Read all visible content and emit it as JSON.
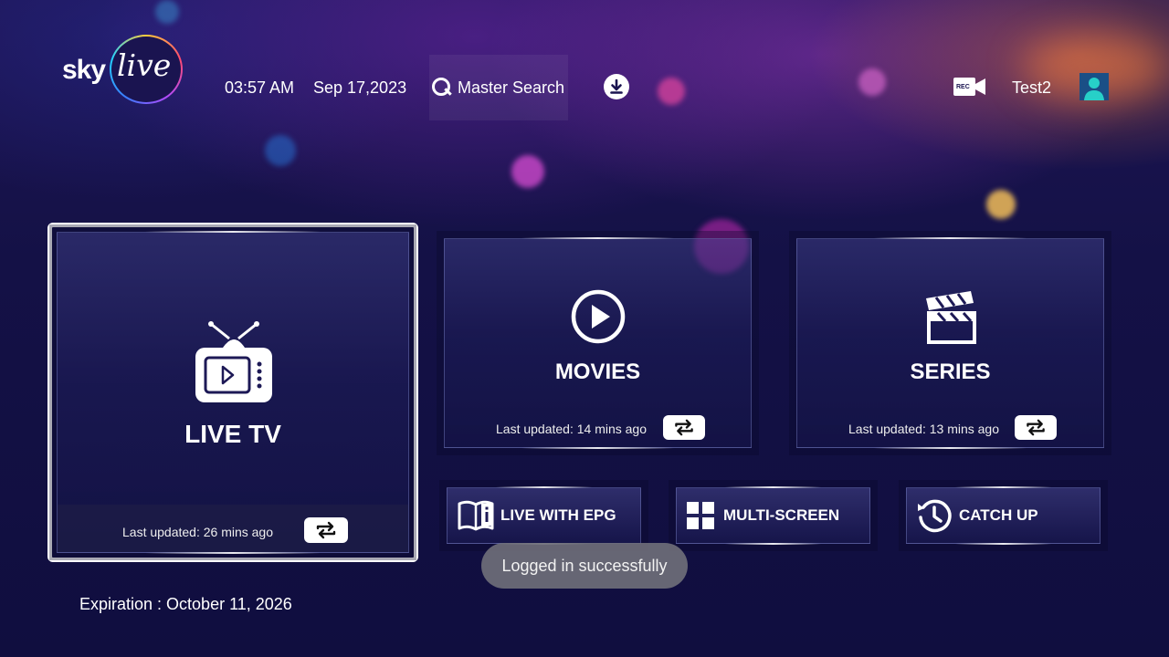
{
  "header": {
    "logo": {
      "brand_left": "sky",
      "brand_right": "live"
    },
    "time": "03:57 AM",
    "date": "Sep 17,2023",
    "search": {
      "label": "Master Search",
      "icon": "search-icon"
    },
    "download_icon": "download-icon",
    "record_icon": "rec-camera-icon",
    "record_badge": "REC",
    "username": "Test2",
    "avatar_icon": "user-avatar-icon"
  },
  "tiles": {
    "live_tv": {
      "title": "LIVE TV",
      "updated": "Last updated: 26 mins ago",
      "icon": "tv-icon"
    },
    "movies": {
      "title": "MOVIES",
      "updated": "Last updated: 14 mins ago",
      "icon": "play-icon"
    },
    "series": {
      "title": "SERIES",
      "updated": "Last updated: 13 mins ago",
      "icon": "clapperboard-icon"
    }
  },
  "shortcuts": {
    "epg": {
      "label": "LIVE WITH EPG",
      "icon": "book-info-icon"
    },
    "multi": {
      "label": "MULTI-SCREEN",
      "icon": "grid-icon"
    },
    "catch": {
      "label": "CATCH UP",
      "icon": "history-icon"
    }
  },
  "toast": "Logged in successfully",
  "expiration": "Expiration : October 11, 2026",
  "colors": {
    "background": "#141146",
    "accent": "#ffffff",
    "toast_bg": "#6e6e78"
  }
}
